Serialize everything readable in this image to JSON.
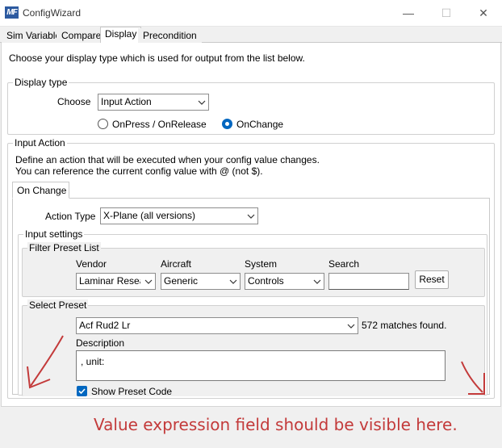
{
  "window": {
    "app_icon_text": "MF",
    "title": "ConfigWizard",
    "minimize_glyph": "—",
    "maximize_glyph": "☐",
    "close_glyph": "✕"
  },
  "tabs": [
    {
      "label": "Sim Variable"
    },
    {
      "label": "Compare"
    },
    {
      "label": "Display"
    },
    {
      "label": "Precondition"
    }
  ],
  "display": {
    "intro": "Choose your display type which is used for output from the list below.",
    "display_type": {
      "title": "Display type",
      "choose_label": "Choose",
      "choose_value": "Input Action",
      "radio_onpress": "OnPress / OnRelease",
      "radio_onchange": "OnChange",
      "selected_radio": "OnChange"
    },
    "input_action": {
      "title": "Input Action",
      "desc_line1": "Define an action that will be executed when your config value changes.",
      "desc_line2": "You can reference the current config value with @ (not $).",
      "tab_label": "On Change",
      "action_type_label": "Action Type",
      "action_type_value": "X-Plane (all versions)",
      "input_settings": {
        "title": "Input settings",
        "filter": {
          "title": "Filter Preset List",
          "vendor_label": "Vendor",
          "vendor_value": "Laminar Research",
          "aircraft_label": "Aircraft",
          "aircraft_value": "Generic",
          "system_label": "System",
          "system_value": "Controls",
          "search_label": "Search",
          "search_value": "",
          "reset_label": "Reset"
        },
        "select_preset": {
          "title": "Select Preset",
          "preset_value": "Acf Rud2 Lr",
          "matches": "572 matches found.",
          "description_label": "Description",
          "description_value": ", unit:",
          "show_code_label": "Show Preset Code",
          "show_code_checked": true
        }
      }
    }
  },
  "annotation": {
    "text": "Value expression field should be visible here.",
    "color": "#c33a3a"
  },
  "colors": {
    "accent": "#0067c0",
    "annotation": "#c33a3a"
  }
}
